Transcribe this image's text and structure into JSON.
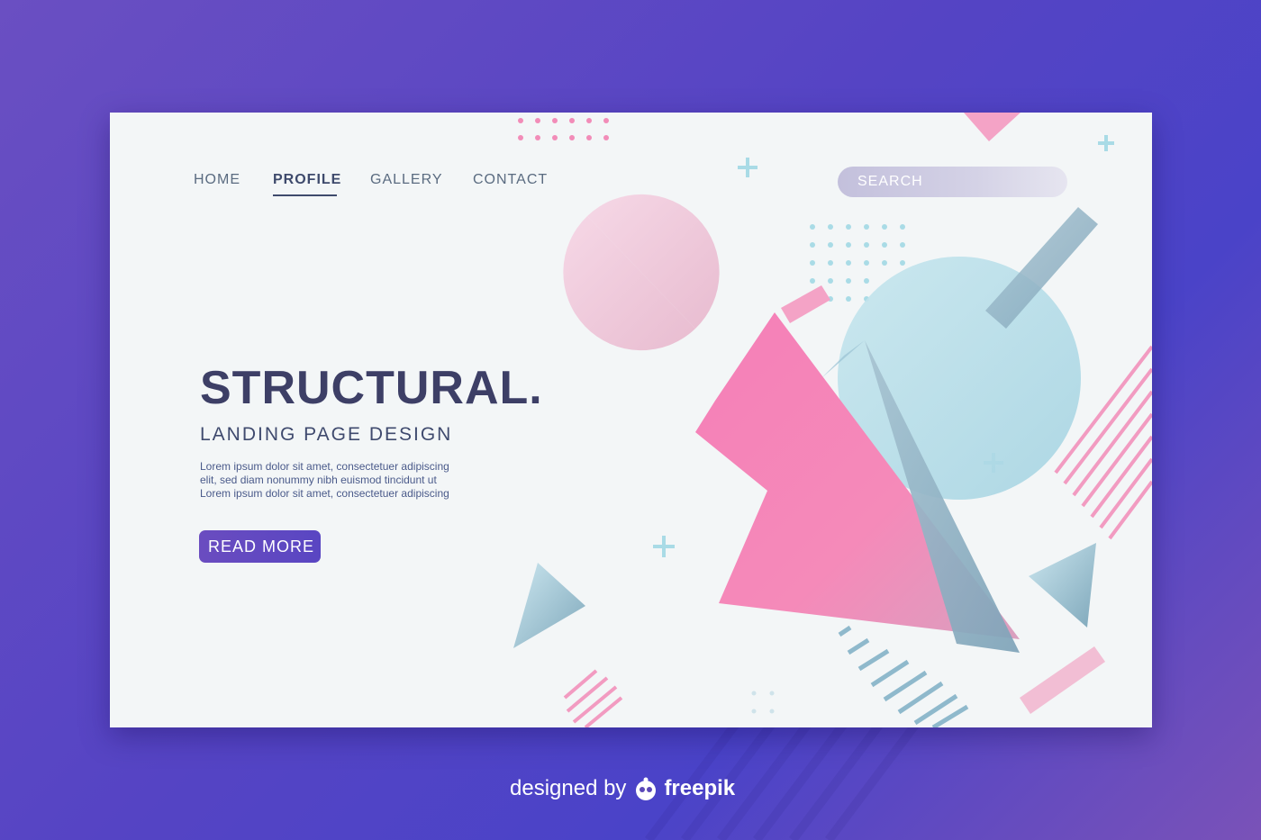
{
  "nav": {
    "items": [
      "HOME",
      "PROFILE",
      "GALLERY",
      "CONTACT"
    ],
    "active": "PROFILE"
  },
  "search": {
    "placeholder": "SEARCH"
  },
  "hero": {
    "title": "STRUCTURAL.",
    "subtitle": "LANDING PAGE DESIGN",
    "body_lines": [
      "Lorem ipsum dolor sit amet, consectetuer adipiscing",
      "elit, sed diam nonummy nibh euismod tincidunt ut",
      "Lorem ipsum dolor sit amet, consectetuer adipiscing"
    ],
    "button_label": "READ MORE"
  },
  "footer": {
    "prefix": "designed by",
    "brand": "freepik"
  },
  "colors": {
    "background": "#5544c4",
    "card": "#f3f6f7",
    "pink": "#f57fb8",
    "light_blue": "#a9dbe6",
    "steel_blue": "#8fb2c4",
    "text_dark": "#3d3f66"
  }
}
